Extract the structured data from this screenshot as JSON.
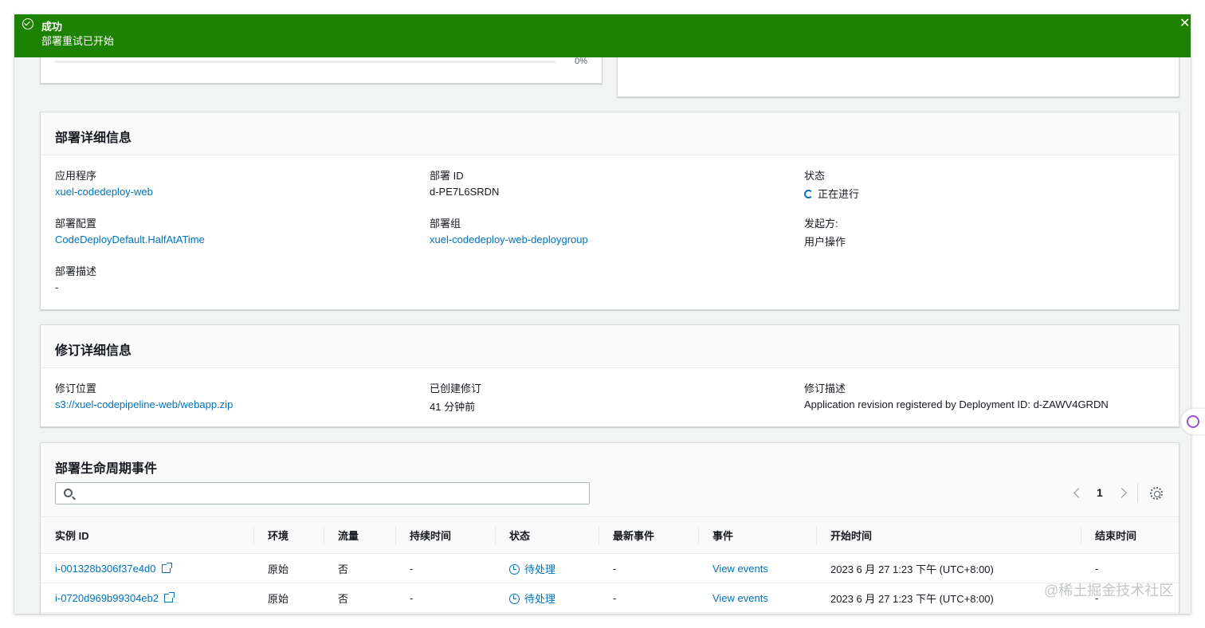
{
  "flash": {
    "title": "成功",
    "message": "部署重试已开始",
    "color": "#1d8102"
  },
  "progress": {
    "value_text": "0%",
    "value": 0
  },
  "deployment_details": {
    "title": "部署详细信息",
    "application_label": "应用程序",
    "application_value": "xuel-codedeploy-web",
    "deployment_id_label": "部署 ID",
    "deployment_id_value": "d-PE7L6SRDN",
    "status_label": "状态",
    "status_value": "正在进行",
    "config_label": "部署配置",
    "config_value": "CodeDeployDefault.HalfAtATime",
    "group_label": "部署组",
    "group_value": "xuel-codedeploy-web-deploygroup",
    "initiator_label": "发起方:",
    "initiator_value": "用户操作",
    "description_label": "部署描述",
    "description_value": "-"
  },
  "revision_details": {
    "title": "修订详细信息",
    "location_label": "修订位置",
    "location_value": "s3://xuel-codepipeline-web/webapp.zip",
    "created_label": "已创建修订",
    "created_value": "41 分钟前",
    "description_label": "修订描述",
    "description_value": "Application revision registered by Deployment ID: d-ZAWV4GRDN"
  },
  "lifecycle_events": {
    "title": "部署生命周期事件",
    "search_placeholder": "",
    "page_number": "1",
    "columns": [
      "实例 ID",
      "环境",
      "流量",
      "持续时间",
      "状态",
      "最新事件",
      "事件",
      "开始时间",
      "结束时间"
    ],
    "rows": [
      {
        "instance_id": "i-001328b306f37e4d0",
        "environment": "原始",
        "traffic": "否",
        "duration": "-",
        "status": "待处理",
        "latest_event": "-",
        "events": "View events",
        "start_time": "2023 6 月 27 1:23 下午 (UTC+8:00)",
        "end_time": "-"
      },
      {
        "instance_id": "i-0720d969b99304eb2",
        "environment": "原始",
        "traffic": "否",
        "duration": "-",
        "status": "待处理",
        "latest_event": "-",
        "events": "View events",
        "start_time": "2023 6 月 27 1:23 下午 (UTC+8:00)",
        "end_time": "-"
      }
    ]
  },
  "watermark": "@稀土掘金技术社区",
  "colors": {
    "link": "#0073bb",
    "success": "#1d8102",
    "background": "#f2f3f3"
  }
}
